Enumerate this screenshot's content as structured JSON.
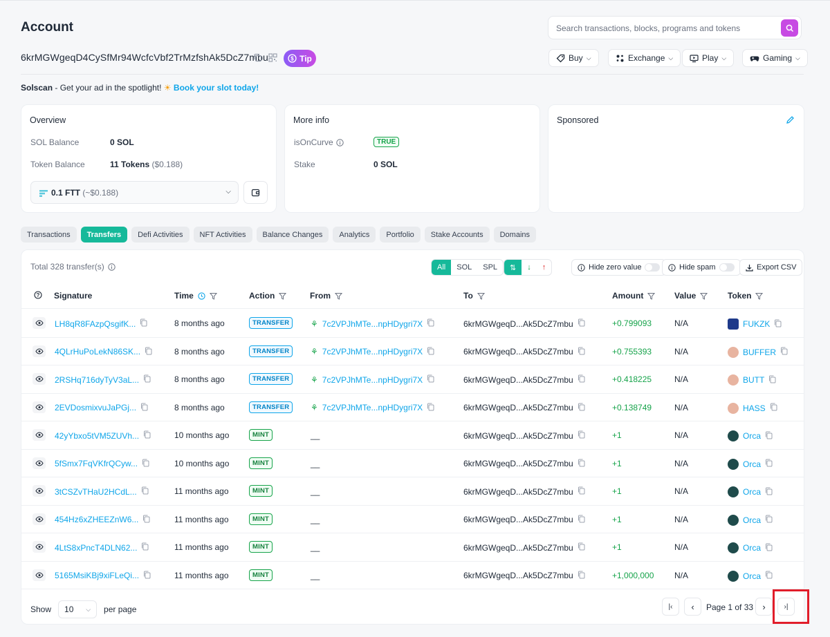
{
  "page": {
    "title": "Account",
    "address": "6krMGWgeqD4CySfMr94WcfcVbf2TrMzfshAk5DcZ7mbu",
    "tip_label": "Tip",
    "search_placeholder": "Search transactions, blocks, programs and tokens"
  },
  "top_nav": [
    "Buy",
    "Exchange",
    "Play",
    "Gaming"
  ],
  "promo": {
    "brand": "Solscan",
    "text": " - Get your ad in the spotlight! ",
    "link": "Book your slot today!"
  },
  "overview": {
    "title": "Overview",
    "sol_balance_label": "SOL Balance",
    "sol_balance_value": "0 SOL",
    "token_balance_label": "Token Balance",
    "token_balance_value": "11 Tokens",
    "token_balance_usd": "($0.188)",
    "selected_token": "0.1 FTT",
    "selected_token_usd": "(~$0.188)"
  },
  "more_info": {
    "title": "More info",
    "is_on_curve_label": "isOnCurve",
    "is_on_curve_value": "TRUE",
    "stake_label": "Stake",
    "stake_value": "0 SOL"
  },
  "sponsored": {
    "title": "Sponsored"
  },
  "tabs": [
    "Transactions",
    "Transfers",
    "Defi Activities",
    "NFT Activities",
    "Balance Changes",
    "Analytics",
    "Portfolio",
    "Stake Accounts",
    "Domains"
  ],
  "active_tab": "Transfers",
  "table": {
    "total": "Total 328 transfer(s)",
    "filters": {
      "all": "All",
      "sol": "SOL",
      "spl": "SPL"
    },
    "hide_zero": "Hide zero value",
    "hide_spam": "Hide spam",
    "export": "Export CSV",
    "columns": [
      "Signature",
      "Time",
      "Action",
      "From",
      "To",
      "Amount",
      "Value",
      "Token"
    ],
    "rows": [
      {
        "sig": "LH8qR8FAzpQsgifK...",
        "time": "8 months ago",
        "action": "TRANSFER",
        "from": "7c2VPJhMTe...npHDygri7X",
        "to": "6krMGWgeqD...Ak5DcZ7mbu",
        "amount": "+0.799093",
        "value": "N/A",
        "token": "FUKZK",
        "token_color": "#1e3a8a"
      },
      {
        "sig": "4QLrHuPoLekN86SK...",
        "time": "8 months ago",
        "action": "TRANSFER",
        "from": "7c2VPJhMTe...npHDygri7X",
        "to": "6krMGWgeqD...Ak5DcZ7mbu",
        "amount": "+0.755393",
        "value": "N/A",
        "token": "BUFFER",
        "token_color": "#e8b4a0"
      },
      {
        "sig": "2RSHq716dyTyV3aL...",
        "time": "8 months ago",
        "action": "TRANSFER",
        "from": "7c2VPJhMTe...npHDygri7X",
        "to": "6krMGWgeqD...Ak5DcZ7mbu",
        "amount": "+0.418225",
        "value": "N/A",
        "token": "BUTT",
        "token_color": "#e8b4a0"
      },
      {
        "sig": "2EVDosmixvuJaPGj...",
        "time": "8 months ago",
        "action": "TRANSFER",
        "from": "7c2VPJhMTe...npHDygri7X",
        "to": "6krMGWgeqD...Ak5DcZ7mbu",
        "amount": "+0.138749",
        "value": "N/A",
        "token": "HASS",
        "token_color": "#e8b4a0"
      },
      {
        "sig": "42yYbxo5tVM5ZUVh...",
        "time": "10 months ago",
        "action": "MINT",
        "from": "__",
        "to": "6krMGWgeqD...Ak5DcZ7mbu",
        "amount": "+1",
        "value": "N/A",
        "token": "Orca",
        "token_color": "#1f4b4b"
      },
      {
        "sig": "5fSmx7FqVKfrQCyw...",
        "time": "10 months ago",
        "action": "MINT",
        "from": "__",
        "to": "6krMGWgeqD...Ak5DcZ7mbu",
        "amount": "+1",
        "value": "N/A",
        "token": "Orca",
        "token_color": "#1f4b4b"
      },
      {
        "sig": "3tCSZvTHaU2HCdL...",
        "time": "11 months ago",
        "action": "MINT",
        "from": "__",
        "to": "6krMGWgeqD...Ak5DcZ7mbu",
        "amount": "+1",
        "value": "N/A",
        "token": "Orca",
        "token_color": "#1f4b4b"
      },
      {
        "sig": "454Hz6xZHEEZnW6...",
        "time": "11 months ago",
        "action": "MINT",
        "from": "__",
        "to": "6krMGWgeqD...Ak5DcZ7mbu",
        "amount": "+1",
        "value": "N/A",
        "token": "Orca",
        "token_color": "#1f4b4b"
      },
      {
        "sig": "4LtS8xPncT4DLN62...",
        "time": "11 months ago",
        "action": "MINT",
        "from": "__",
        "to": "6krMGWgeqD...Ak5DcZ7mbu",
        "amount": "+1",
        "value": "N/A",
        "token": "Orca",
        "token_color": "#1f4b4b"
      },
      {
        "sig": "5165MsiKBj9xiFLeQi...",
        "time": "11 months ago",
        "action": "MINT",
        "from": "__",
        "to": "6krMGWgeqD...Ak5DcZ7mbu",
        "amount": "+1,000,000",
        "value": "N/A",
        "token": "Orca",
        "token_color": "#1f4b4b"
      }
    ]
  },
  "pagination": {
    "show_label": "Show",
    "per_page_value": "10",
    "per_page_label": "per page",
    "page_text": "Page 1 of 33"
  },
  "colors": {
    "accent": "#16b99a",
    "link": "#0ea5e9",
    "highlight": "#e11d2a"
  }
}
